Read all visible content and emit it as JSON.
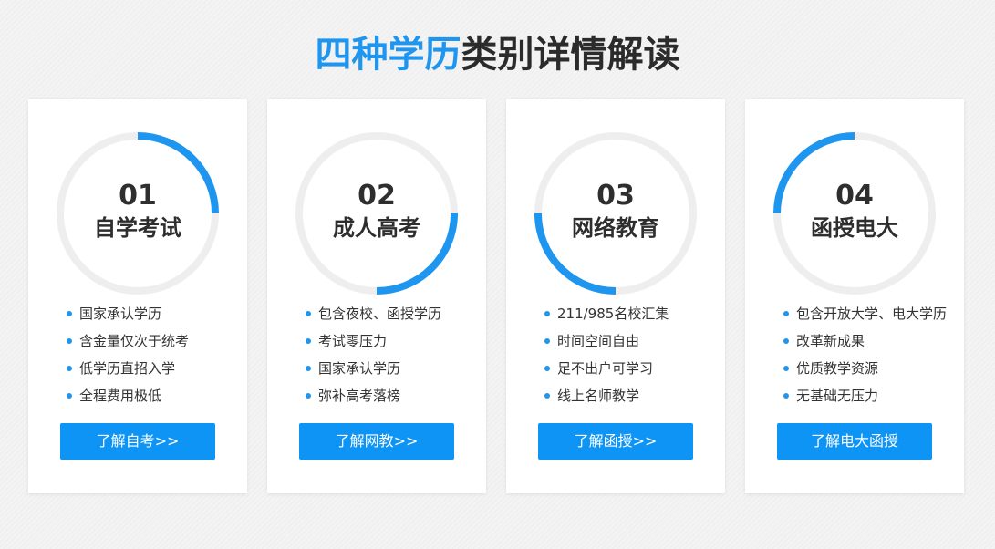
{
  "heading": {
    "highlight": "四种学历",
    "rest": "类别详情解读"
  },
  "accent_color": "#1e96f0",
  "ring_track_color": "#eeeeee",
  "cards": [
    {
      "number": "01",
      "name": "自学考试",
      "progress_arc": {
        "start_angle_deg": 270,
        "end_angle_deg": 360
      },
      "features": [
        "国家承认学历",
        "含金量仅次于统考",
        "低学历直招入学",
        "全程费用极低"
      ],
      "button_label": "了解自考>>"
    },
    {
      "number": "02",
      "name": "成人高考",
      "progress_arc": {
        "start_angle_deg": 0,
        "end_angle_deg": 90
      },
      "features": [
        "包含夜校、函授学历",
        "考试零压力",
        "国家承认学历",
        "弥补高考落榜"
      ],
      "button_label": "了解网教>>"
    },
    {
      "number": "03",
      "name": "网络教育",
      "progress_arc": {
        "start_angle_deg": 90,
        "end_angle_deg": 180
      },
      "features": [
        "211/985名校汇集",
        "时间空间自由",
        "足不出户可学习",
        "线上名师教学"
      ],
      "button_label": "了解函授>>"
    },
    {
      "number": "04",
      "name": "函授电大",
      "progress_arc": {
        "start_angle_deg": 180,
        "end_angle_deg": 270
      },
      "features": [
        "包含开放大学、电大学历",
        "改革新成果",
        "优质教学资源",
        "无基础无压力"
      ],
      "button_label": "了解电大函授"
    }
  ]
}
